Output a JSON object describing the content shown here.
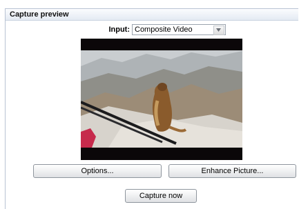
{
  "panel": {
    "title": "Capture preview"
  },
  "input": {
    "label": "Input:",
    "selected": "Composite Video"
  },
  "buttons": {
    "options": "Options...",
    "enhance": "Enhance Picture...",
    "capture": "Capture now"
  }
}
